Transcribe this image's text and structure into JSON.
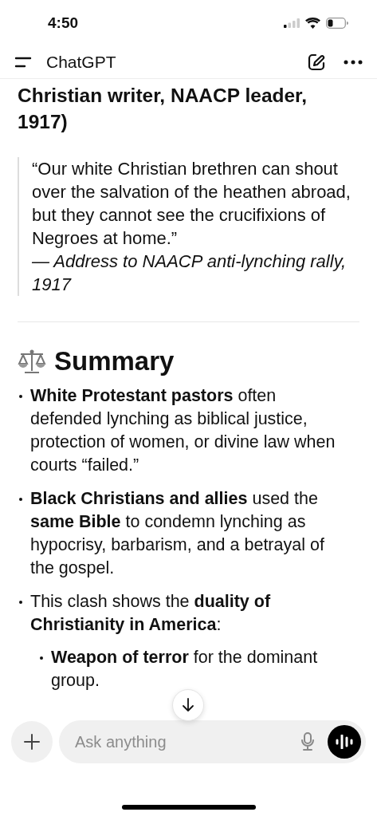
{
  "status_bar": {
    "time": "4:50"
  },
  "header": {
    "title": "ChatGPT"
  },
  "heading": "Christian writer, NAACP leader, 1917)",
  "quote": {
    "text": "“Our white Christian brethren can shout over the salvation of the heathen abroad, but they cannot see the crucifixions of Negroes at home.”",
    "source": "— Address to NAACP anti-lynching rally, 1917"
  },
  "section": {
    "title": "Summary"
  },
  "bullets": [
    {
      "text": "**White Protestant pastors** often defended lynching as biblical justice, protection of women, or divine law when courts “failed.”"
    },
    {
      "text": "**Black Christians and allies** used the **same Bible** to condemn lynching as hypocrisy, barbarism, and a betrayal of the gospel."
    },
    {
      "text": "This clash shows the **duality of Christianity in America**:",
      "children": [
        {
          "text": "**Weapon of terror** for the dominant group."
        }
      ]
    }
  ],
  "composer": {
    "placeholder": "Ask anything"
  }
}
